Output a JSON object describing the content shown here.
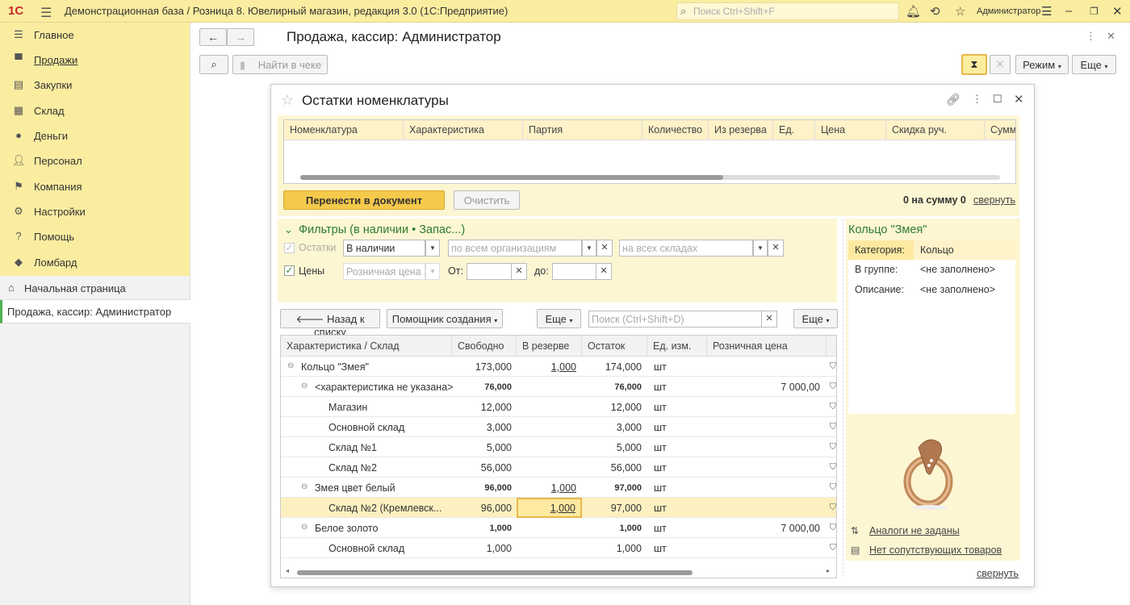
{
  "topbar": {
    "logo": "1С",
    "title": "Демонстрационная база / Розница 8. Ювелирный магазин, редакция 3.0  (1С:Предприятие)",
    "search_placeholder": "Поиск Ctrl+Shift+F",
    "user": "Администратор"
  },
  "sidebar": {
    "items": [
      {
        "label": "Главное",
        "icon": "menu-icon"
      },
      {
        "label": "Продажи",
        "icon": "cart-icon"
      },
      {
        "label": "Закупки",
        "icon": "bars-icon"
      },
      {
        "label": "Склад",
        "icon": "warehouse-icon"
      },
      {
        "label": "Деньги",
        "icon": "money-icon"
      },
      {
        "label": "Персонал",
        "icon": "people-icon"
      },
      {
        "label": "Компания",
        "icon": "flag-icon"
      },
      {
        "label": "Настройки",
        "icon": "gear-icon"
      },
      {
        "label": "Помощь",
        "icon": "help-icon"
      },
      {
        "label": "Ломбард",
        "icon": "diamond-icon"
      }
    ],
    "home": "Начальная страница",
    "open_window": "Продажа, кассир: Администратор"
  },
  "form": {
    "title": "Продажа, кассир: Администратор",
    "find_placeholder": "Найти в чеке",
    "mode_button": "Режим",
    "more_button": "Еще"
  },
  "dialog": {
    "title": "Остатки номенклатуры",
    "top_grid_headers": [
      "Номенклатура",
      "Характеристика",
      "Партия",
      "Количество",
      "Из резерва",
      "Ед.",
      "Цена",
      "Скидка руч.",
      "Сумм"
    ],
    "transfer_button": "Перенести в документ",
    "clear_button": "Очистить",
    "total_text": "0 на сумму 0",
    "collapse_link": "свернуть",
    "filters": {
      "title": "Фильтры (в наличии • Запас...)",
      "stock_label": "Остатки",
      "stock_value": "В наличии",
      "org_placeholder": "по всем организациям",
      "warehouse_placeholder": "на всех складах",
      "prices_label": "Цены",
      "price_type": "Розничная цена",
      "from_label": "От:",
      "to_label": "до:"
    },
    "toolbar": {
      "back_button": "Назад к списку",
      "wizard_button": "Помощник создания",
      "more_button": "Еще",
      "search_placeholder": "Поиск (Ctrl+Shift+D)",
      "more_button2": "Еще"
    },
    "table": {
      "headers": [
        "Характеристика / Склад",
        "Свободно",
        "В резерве",
        "Остаток",
        "Ед. изм.",
        "Розничная цена"
      ],
      "rows": [
        {
          "name": "Кольцо \"Змея\"",
          "free": "173,000",
          "reserve": "1,000",
          "rest": "174,000",
          "unit": "шт",
          "price": ""
        },
        {
          "name": "<характеристика не указана>",
          "free": "76,000",
          "reserve": "",
          "rest": "76,000",
          "unit": "шт",
          "price": "7 000,00"
        },
        {
          "name": "Магазин",
          "free": "12,000",
          "reserve": "",
          "rest": "12,000",
          "unit": "шт",
          "price": ""
        },
        {
          "name": "Основной склад",
          "free": "3,000",
          "reserve": "",
          "rest": "3,000",
          "unit": "шт",
          "price": ""
        },
        {
          "name": "Склад №1",
          "free": "5,000",
          "reserve": "",
          "rest": "5,000",
          "unit": "шт",
          "price": ""
        },
        {
          "name": "Склад №2",
          "free": "56,000",
          "reserve": "",
          "rest": "56,000",
          "unit": "шт",
          "price": ""
        },
        {
          "name": "Змея цвет белый",
          "free": "96,000",
          "reserve": "1,000",
          "rest": "97,000",
          "unit": "шт",
          "price": ""
        },
        {
          "name": "Склад №2 (Кремлевск...",
          "free": "96,000",
          "reserve": "1,000",
          "rest": "97,000",
          "unit": "шт",
          "price": ""
        },
        {
          "name": "Белое золото",
          "free": "1,000",
          "reserve": "",
          "rest": "1,000",
          "unit": "шт",
          "price": "7 000,00"
        },
        {
          "name": "Основной склад",
          "free": "1,000",
          "reserve": "",
          "rest": "1,000",
          "unit": "шт",
          "price": ""
        }
      ]
    },
    "details": {
      "title": "Кольцо \"Змея\"",
      "category_label": "Категория:",
      "category_value": "Кольцо",
      "group_label": "В группе:",
      "group_value": "<не заполнено>",
      "description_label": "Описание:",
      "description_value": "<не заполнено>",
      "analogs_link": "Аналоги не заданы",
      "related_link": "Нет сопутствующих товаров",
      "collapse_link": "свернуть"
    }
  }
}
